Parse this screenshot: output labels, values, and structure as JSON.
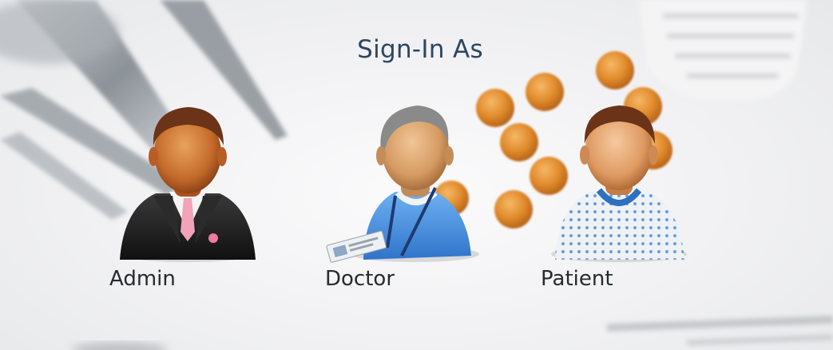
{
  "page": {
    "title": "Sign-In As"
  },
  "roles": [
    {
      "label": "Admin",
      "icon": "admin-avatar-icon"
    },
    {
      "label": "Doctor",
      "icon": "doctor-avatar-icon"
    },
    {
      "label": "Patient",
      "icon": "patient-avatar-icon"
    }
  ],
  "colors": {
    "title": "#2c4660",
    "label": "#262b30",
    "pill": "#e08a2c",
    "doctor_shirt": "#4a90e2",
    "admin_suit": "#1e1e1e",
    "hair_brown": "#6b3418",
    "hair_gray": "#8a8a8a"
  }
}
